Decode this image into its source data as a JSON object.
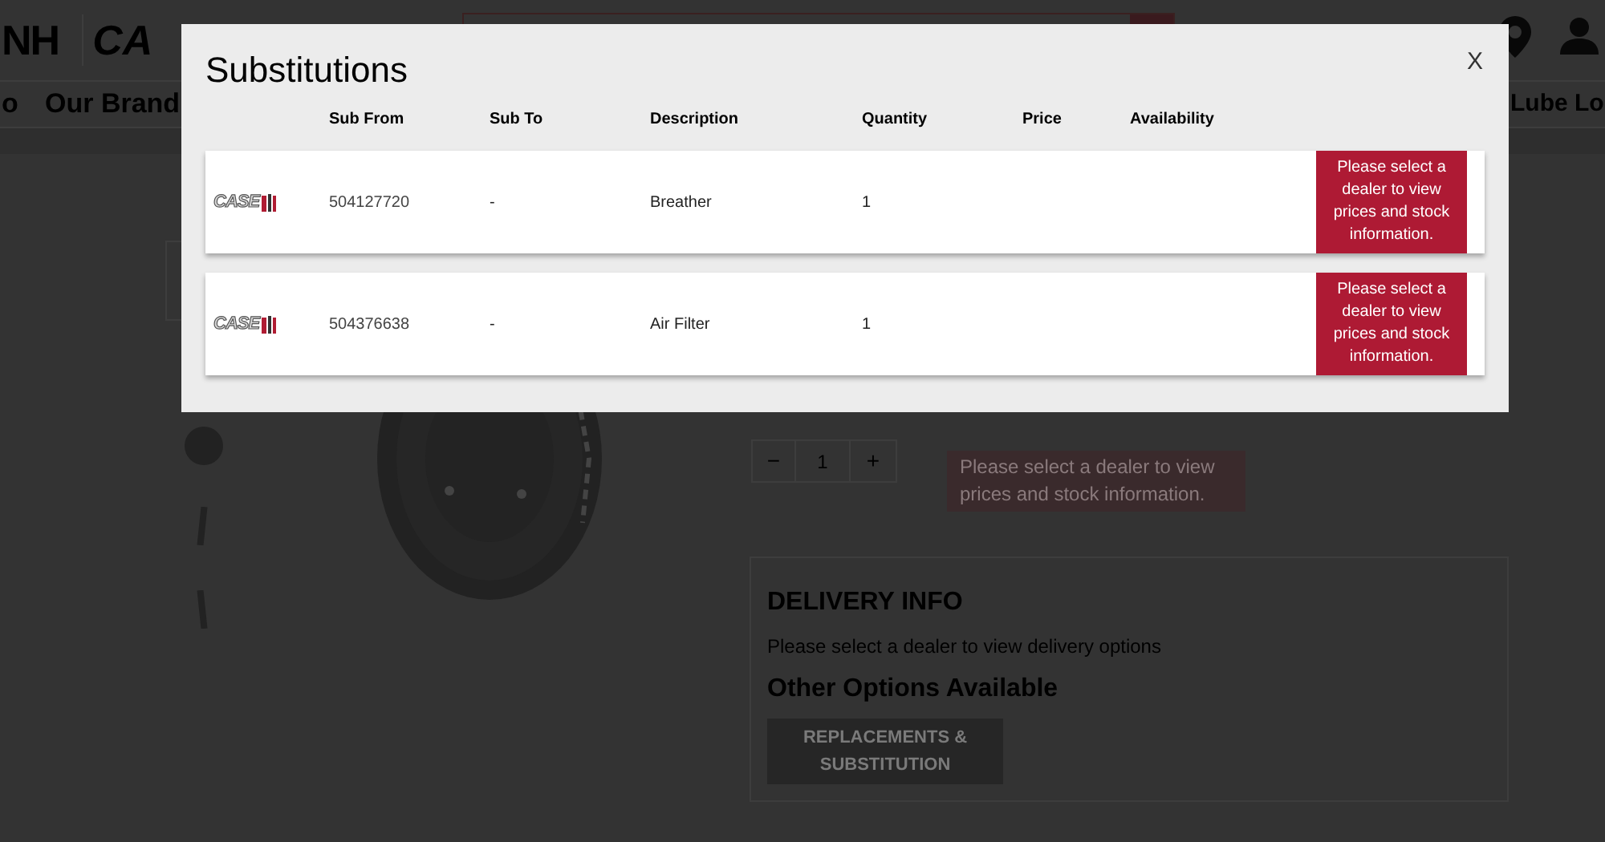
{
  "header": {
    "logo_text": "NH",
    "brand_logo_text": "CA"
  },
  "nav": {
    "items": [
      "o",
      "Our Brand",
      "Lube Lo"
    ]
  },
  "product": {
    "quantity": "1",
    "decrement": "−",
    "increment": "+",
    "price_notice": "Please select a dealer to view prices and stock information.",
    "delivery_title": "DELIVERY INFO",
    "delivery_text": "Please select a dealer to view delivery options",
    "options_title": "Other Options Available",
    "options_button": "REPLACEMENTS & SUBSTITUTION"
  },
  "modal": {
    "title": "Substitutions",
    "close": "X",
    "columns": [
      "Sub From",
      "Sub To",
      "Description",
      "Quantity",
      "Price",
      "Availability"
    ],
    "rows": [
      {
        "logo_text": "CASE",
        "sub_from": "504127720",
        "sub_to": "-",
        "description": "Breather",
        "quantity": "1",
        "notice": "Please select a dealer to view prices and stock information."
      },
      {
        "logo_text": "CASE",
        "sub_from": "504376638",
        "sub_to": "-",
        "description": "Air Filter",
        "quantity": "1",
        "notice": "Please select a dealer to view prices and stock information."
      }
    ]
  }
}
